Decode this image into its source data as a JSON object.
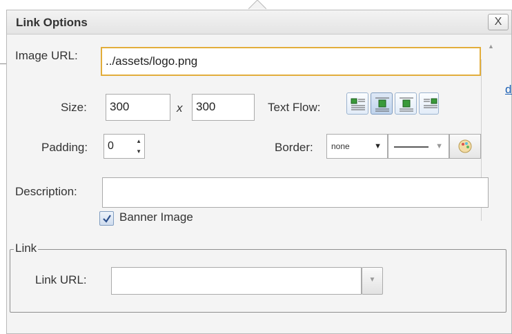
{
  "dialog": {
    "title": "Link Options",
    "close_label": "X"
  },
  "background": {
    "link_text": "di"
  },
  "image_url": {
    "label": "Image URL:",
    "value": "../assets/logo.png"
  },
  "size": {
    "label": "Size:",
    "width": "300",
    "separator": "x",
    "height": "300"
  },
  "text_flow": {
    "label": "Text Flow:",
    "options": [
      "inline-left",
      "block-center",
      "block-left",
      "inline-right"
    ],
    "selected": "block-center"
  },
  "padding": {
    "label": "Padding:",
    "value": "0"
  },
  "border": {
    "label": "Border:",
    "style_value": "none",
    "line_value": "solid-line"
  },
  "description": {
    "label": "Description:",
    "value": ""
  },
  "banner": {
    "label": "Banner Image",
    "checked": true
  },
  "link": {
    "legend": "Link",
    "url_label": "Link URL:",
    "url_value": ""
  },
  "colors": {
    "focus_border": "#e2ad3a",
    "link_blue": "#1a5fb4"
  }
}
